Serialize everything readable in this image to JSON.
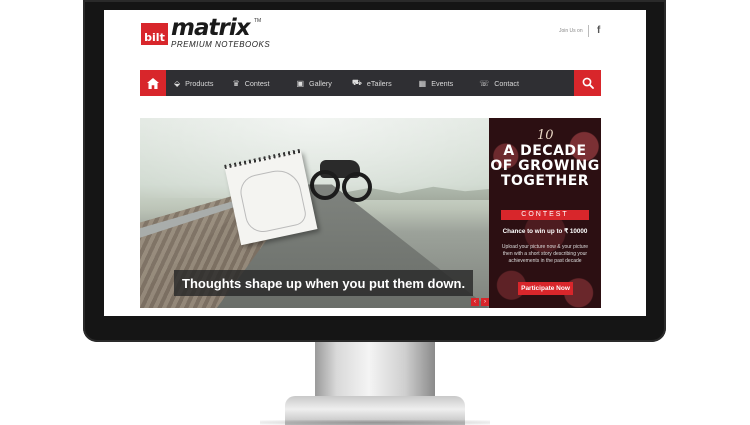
{
  "header": {
    "logo_mark": "bilt",
    "logo_name": "matrix",
    "logo_tm": "TM",
    "logo_tagline": "PREMIUM NOTEBOOKS",
    "top_link": "Join Us on",
    "social_icon": "facebook-icon"
  },
  "nav": {
    "items": [
      {
        "label": "Products",
        "icon": "notebook-icon",
        "glyph": "⬙"
      },
      {
        "label": "Contest",
        "icon": "trophy-icon",
        "glyph": "🏆"
      },
      {
        "label": "Gallery",
        "icon": "picture-icon",
        "glyph": "▣"
      },
      {
        "label": "eTailers",
        "icon": "cart-icon",
        "glyph": "🛒"
      },
      {
        "label": "Events",
        "icon": "calendar-icon",
        "glyph": "▦"
      },
      {
        "label": "Contact",
        "icon": "phone-icon",
        "glyph": "☏"
      }
    ],
    "home_icon": "home-icon",
    "search_icon": "search-icon"
  },
  "banner": {
    "caption": "Thoughts shape up when you put them down.",
    "prev": "‹",
    "next": "›"
  },
  "promo": {
    "ten": "10",
    "title_line1": "A DECADE",
    "title_line2": "OF GROWING",
    "title_line3": "TOGETHER",
    "contest_label": "CONTEST",
    "prize_text": "Chance to win up to ₹ 10000",
    "body_text": "Upload your picture now & your picture then with a short story describing your achievements in the past decade",
    "button_label": "Participate Now"
  },
  "colors": {
    "accent": "#d8262b",
    "nav_bg": "#2f2f33",
    "monitor_bezel": "#151515"
  }
}
